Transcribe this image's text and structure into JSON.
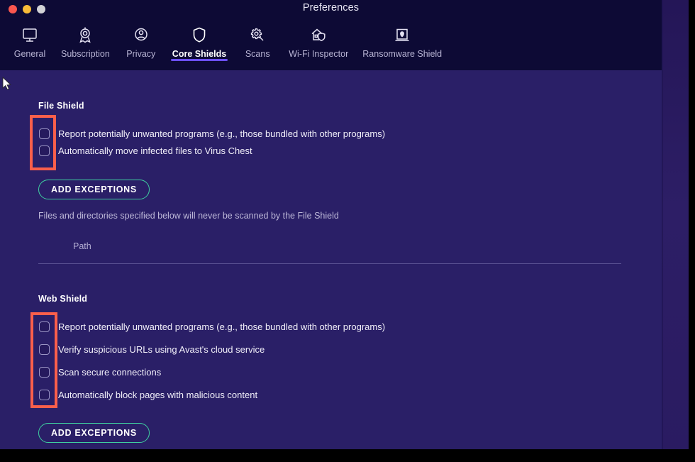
{
  "window": {
    "title": "Preferences",
    "traffic_lights": [
      "close",
      "minimize",
      "zoom"
    ]
  },
  "toolbar": {
    "tabs": [
      {
        "label": "General",
        "icon": "monitor-icon",
        "active": false
      },
      {
        "label": "Subscription",
        "icon": "award-ribbon-icon",
        "active": false
      },
      {
        "label": "Privacy",
        "icon": "person-badge-icon",
        "active": false
      },
      {
        "label": "Core Shields",
        "icon": "shield-icon",
        "active": true
      },
      {
        "label": "Scans",
        "icon": "magnifier-gear-icon",
        "active": false
      },
      {
        "label": "Wi-Fi Inspector",
        "icon": "house-shield-icon",
        "active": false
      },
      {
        "label": "Ransomware Shield",
        "icon": "laptop-lock-icon",
        "active": false
      }
    ],
    "active_accent_color": "#6b4ff3"
  },
  "sections": [
    {
      "id": "file-shield",
      "title": "File Shield",
      "options": [
        {
          "label": "Report potentially unwanted programs (e.g., those bundled with other programs)",
          "checked": false
        },
        {
          "label": "Automatically move infected files to Virus Chest",
          "checked": false
        }
      ],
      "button_label": "ADD EXCEPTIONS",
      "helper_text": "Files and directories specified below will never be scanned by the File Shield",
      "table_header": "Path"
    },
    {
      "id": "web-shield",
      "title": "Web Shield",
      "options": [
        {
          "label": "Report potentially unwanted programs (e.g., those bundled with other programs)",
          "checked": false
        },
        {
          "label": "Verify suspicious URLs using Avast's cloud service",
          "checked": false
        },
        {
          "label": "Scan secure connections",
          "checked": false
        },
        {
          "label": "Automatically block pages with malicious content",
          "checked": false
        }
      ],
      "button_label": "ADD EXCEPTIONS"
    }
  ],
  "annotations": {
    "highlight_color": "#fb5f4b",
    "boxes": [
      {
        "name": "file-shield-checkbox-group-highlight"
      },
      {
        "name": "web-shield-checkbox-group-highlight"
      }
    ]
  },
  "colors": {
    "header_bg": "#0d0a35",
    "content_bg": "#2a1f67",
    "button_border": "#3fcfa0",
    "accent": "#6b4ff3",
    "text_primary": "#ffffff",
    "text_secondary": "#bdb8d8"
  }
}
